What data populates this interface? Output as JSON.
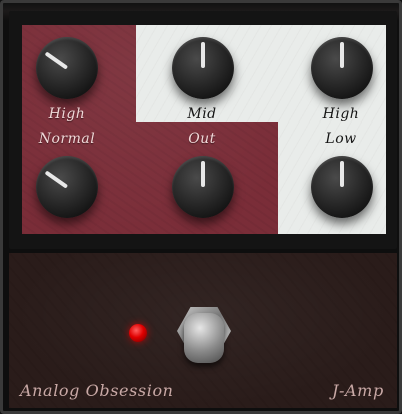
{
  "knobs": {
    "top_left": {
      "label": "High",
      "angle_deg": -55
    },
    "top_mid": {
      "label": "Mid",
      "angle_deg": 0
    },
    "top_right": {
      "label": "High",
      "angle_deg": 0
    },
    "bot_left": {
      "label": "Normal",
      "angle_deg": -55
    },
    "bot_mid": {
      "label": "Out",
      "angle_deg": 0
    },
    "bot_right": {
      "label": "Low",
      "angle_deg": 0
    }
  },
  "footer": {
    "brand_left": "Analog Obsession",
    "brand_right": "J-Amp"
  },
  "colors": {
    "panel_red": "#7a2d38",
    "panel_white": "#e9ecea",
    "led": "#e00000"
  }
}
